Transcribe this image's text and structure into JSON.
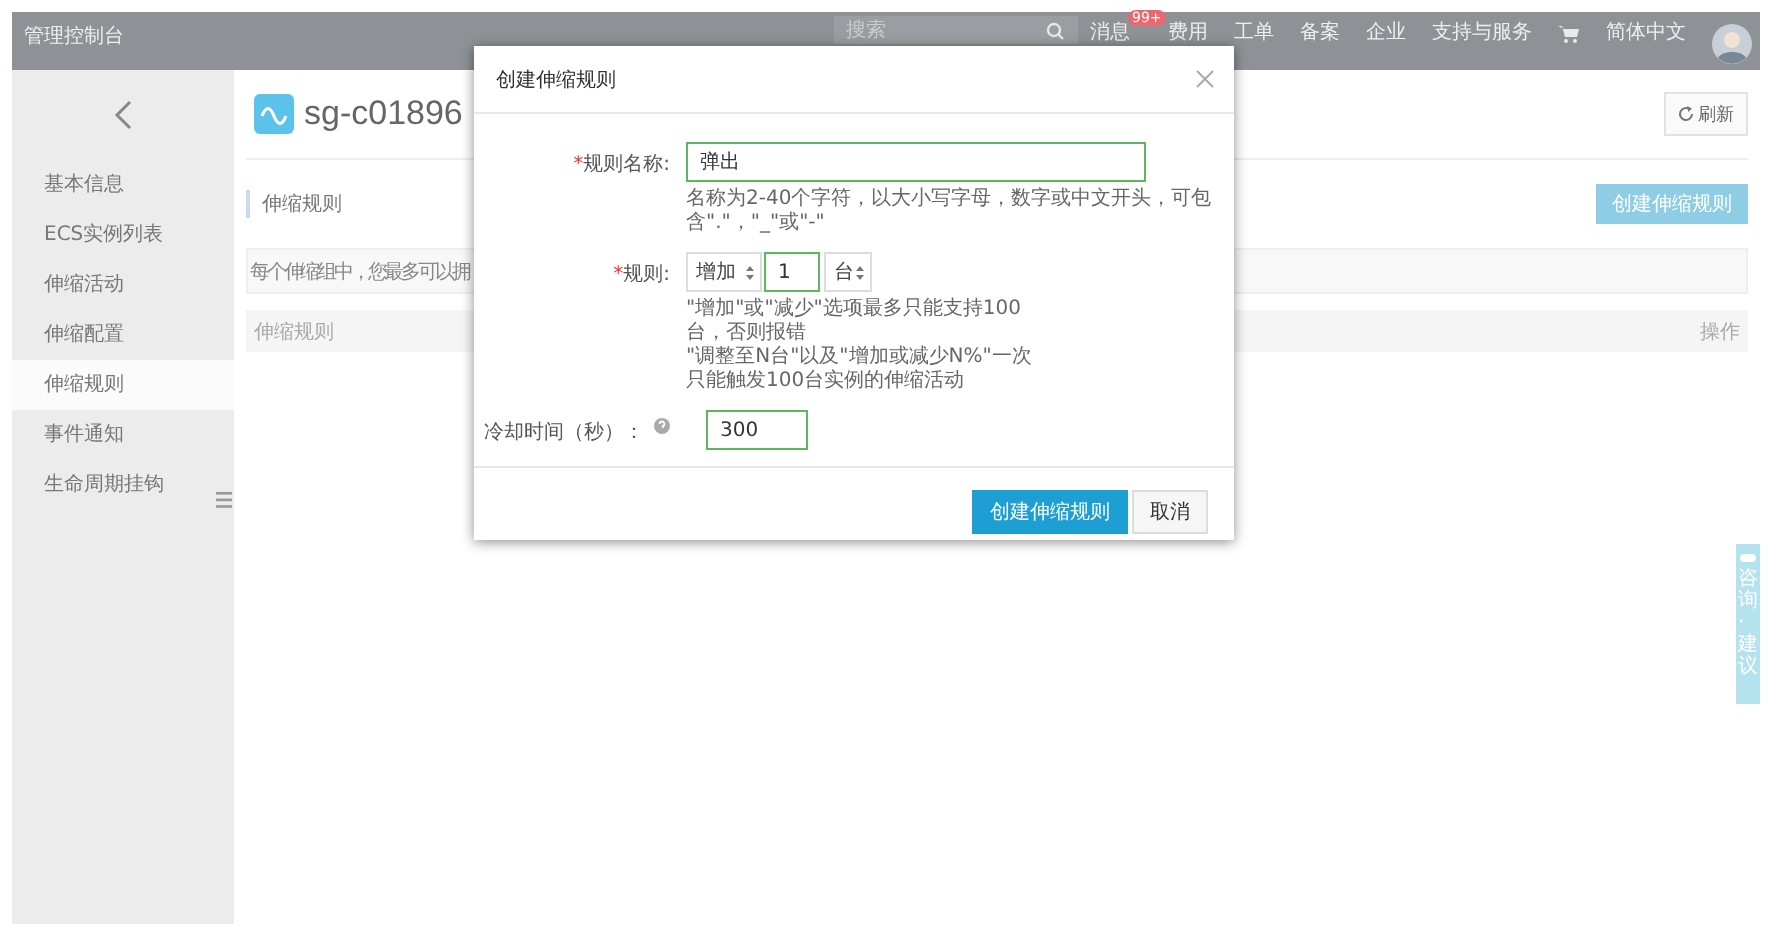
{
  "topbar": {
    "title": "管理控制台",
    "search": {
      "placeholder": "搜索"
    },
    "nav": [
      {
        "label": "消息",
        "badge": "99+"
      },
      {
        "label": "费用"
      },
      {
        "label": "工单"
      },
      {
        "label": "备案"
      },
      {
        "label": "企业"
      },
      {
        "label": "支持与服务"
      }
    ],
    "language": "简体中文"
  },
  "sidebar": {
    "items": [
      {
        "label": "基本信息",
        "selected": false
      },
      {
        "label": "ECS实例列表",
        "selected": false
      },
      {
        "label": "伸缩活动",
        "selected": false
      },
      {
        "label": "伸缩配置",
        "selected": false
      },
      {
        "label": "伸缩规则",
        "selected": true
      },
      {
        "label": "事件通知",
        "selected": false
      },
      {
        "label": "生命周期挂钩",
        "selected": false
      }
    ]
  },
  "page": {
    "title": "sg-c01896",
    "refresh": "刷新",
    "section": "伸缩规则",
    "create_button": "创建伸缩规则",
    "notice": "每个伸缩组中，您最多可以拥",
    "table": {
      "columns": [
        "伸缩规则",
        "操作"
      ]
    }
  },
  "feedback_tab": "咨询·建议",
  "dialog": {
    "title": "创建伸缩规则",
    "fields": [
      {
        "kind": "text",
        "mark": "*",
        "label": "规则名称:",
        "value": "弹出",
        "hint": [
          "名称为2-40个字符，以大小写字母，数字或中文开头，可包",
          "含\".\"，\"_\"或\"-\""
        ]
      },
      {
        "kind": "rule",
        "mark": "*",
        "label": "规则:",
        "action": "增加",
        "value": "1",
        "unit": "台",
        "hint": [
          "\"增加\"或\"减少\"选项最多只能支持100",
          "台，否则报错",
          "\"调整至N台\"以及\"增加或减少N%\"一次",
          "只能触发100台实例的伸缩活动"
        ]
      },
      {
        "kind": "cooldown",
        "label": "冷却时间（秒）：",
        "value": "300"
      }
    ],
    "buttons": [
      {
        "label": "创建伸缩规则",
        "primary": true
      },
      {
        "label": "取消",
        "primary": false
      }
    ]
  }
}
